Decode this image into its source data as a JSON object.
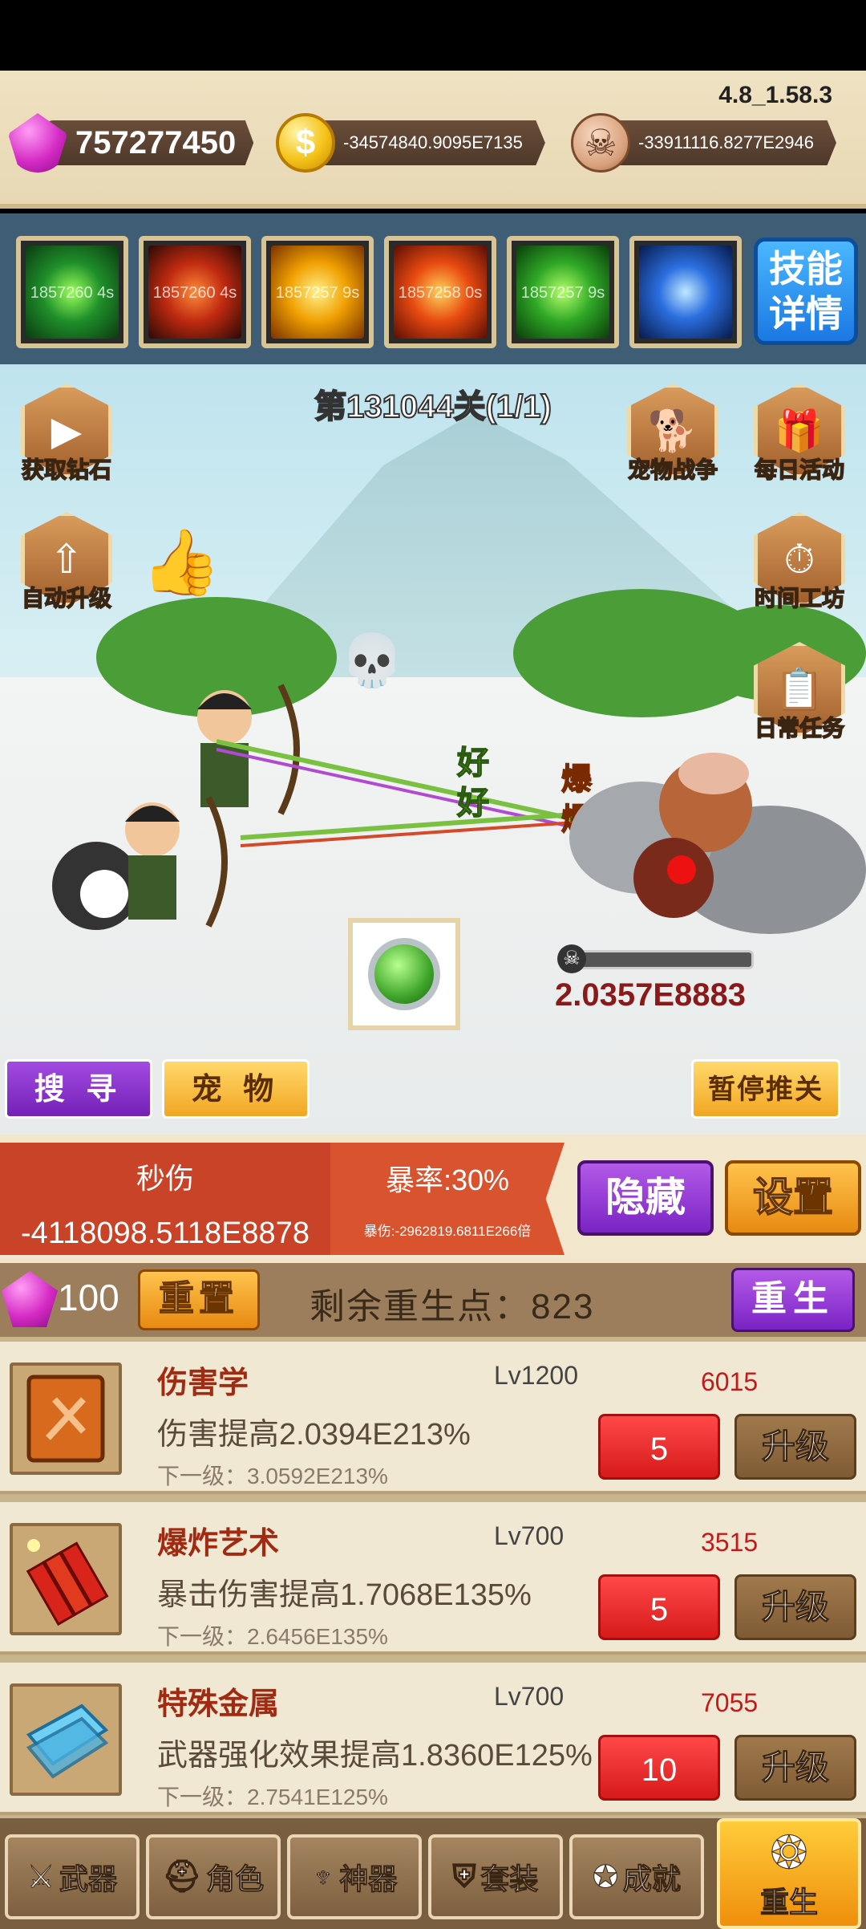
{
  "header": {
    "version": "4.8_1.58.3",
    "gems": "757277450",
    "coins": "-34574840.9095E7135",
    "skulls": "-33911116.8277E2946",
    "coin_symbol": "$"
  },
  "skills": {
    "slots": [
      {
        "icon": "green-arrow-skill-icon",
        "cd": "1857260 4s"
      },
      {
        "icon": "dark-arrow-skill-icon",
        "cd": "1857260 4s"
      },
      {
        "icon": "gold-star-skill-icon",
        "cd": "1857257 9s"
      },
      {
        "icon": "fire-skill-icon",
        "cd": "1857258 0s"
      },
      {
        "icon": "green-bow-skill-icon",
        "cd": "1857257 9s"
      },
      {
        "icon": "lightning-skill-icon",
        "cd": ""
      }
    ],
    "detail_label": "技能详情"
  },
  "battle": {
    "stage": "第131044关(1/1)",
    "left_buttons": [
      {
        "label": "获取钻石",
        "icon": "video-icon"
      },
      {
        "label": "自动升级",
        "icon": "up-arrow-icon"
      }
    ],
    "right_buttons": [
      {
        "label": "宠物战争",
        "icon": "dog-icon"
      },
      {
        "label": "每日活动",
        "icon": "gift-icon"
      },
      {
        "label": "时间工坊",
        "icon": "clock-icon"
      },
      {
        "label": "日常任务",
        "icon": "clipboard-icon"
      }
    ],
    "enemy_hp": "2.0357E8883",
    "floating_texts": [
      "好",
      "好",
      "爆",
      "爆"
    ],
    "search_label": "搜 寻",
    "pet_label": "宠 物",
    "pause_label": "暂停推关"
  },
  "dps": {
    "title": "秒伤",
    "value": "-4118098.5118E8878",
    "crit_rate": "暴率:30%",
    "crit_dmg": "暴伤:-2962819.6811E266倍",
    "hide_label": "隐藏",
    "settings_label": "设置"
  },
  "rebirth": {
    "gem_count": "100",
    "reset_label": "重置",
    "remaining_text": "剩余重生点：823",
    "reborn_label": "重生"
  },
  "upgrades": [
    {
      "name": "伤害学",
      "level": "Lv1200",
      "cost": "6015",
      "desc": "伤害提高2.0394E213%",
      "next": "下一级：3.0592E213%",
      "qty": "5",
      "button": "升级",
      "icon": "book-icon"
    },
    {
      "name": "爆炸艺术",
      "level": "Lv700",
      "cost": "3515",
      "desc": "暴击伤害提高1.7068E135%",
      "next": "下一级：2.6456E135%",
      "qty": "5",
      "button": "升级",
      "icon": "dynamite-icon"
    },
    {
      "name": "特殊金属",
      "level": "Lv700",
      "cost": "7055",
      "desc": "武器强化效果提高1.8360E125%",
      "next": "下一级：2.7541E125%",
      "qty": "10",
      "button": "升级",
      "icon": "metal-plate-icon"
    }
  ],
  "nav": {
    "tabs": [
      {
        "label": "武器",
        "icon": "crossed-swords-icon"
      },
      {
        "label": "角色",
        "icon": "helmet-icon"
      },
      {
        "label": "神器",
        "icon": "artifact-icon"
      },
      {
        "label": "套装",
        "icon": "armor-icon"
      },
      {
        "label": "成就",
        "icon": "medal-icon"
      },
      {
        "label": "重生",
        "icon": "rebirth-flame-icon"
      }
    ]
  }
}
